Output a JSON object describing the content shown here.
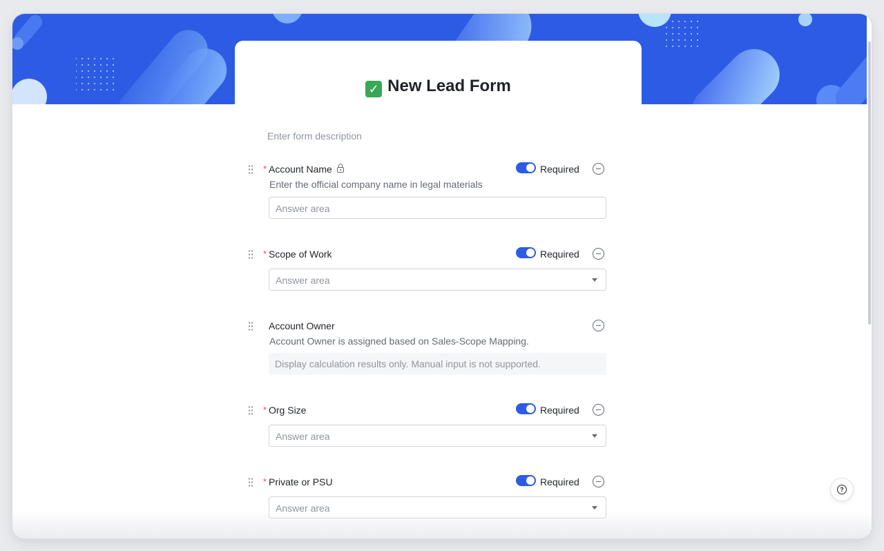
{
  "form": {
    "title_emoji": "✅",
    "title": "New Lead Form",
    "description_placeholder": "Enter form description",
    "fields": [
      {
        "label": "Account Name",
        "required_mark": "*",
        "helper": "Enter the official company name in legal materials",
        "required_label": "Required",
        "required": true,
        "locked": true,
        "input_type": "text",
        "placeholder": "Answer area"
      },
      {
        "label": "Scope of Work",
        "required_mark": "*",
        "required_label": "Required",
        "required": true,
        "input_type": "select",
        "placeholder": "Answer area"
      },
      {
        "label": "Account Owner",
        "helper": "Account Owner is assigned based on Sales-Scope Mapping.",
        "input_type": "readonly",
        "placeholder": "Display calculation results only. Manual input is not supported."
      },
      {
        "label": "Org Size",
        "required_mark": "*",
        "required_label": "Required",
        "required": true,
        "input_type": "select",
        "placeholder": "Answer area"
      },
      {
        "label": "Private or PSU",
        "required_mark": "*",
        "required_label": "Required",
        "required": true,
        "input_type": "select",
        "placeholder": "Answer area"
      }
    ]
  },
  "help": {
    "icon": "help-icon",
    "glyph": "?"
  },
  "colors": {
    "banner": "#2d5be3",
    "toggle_on": "#2d5be3",
    "required_star": "#f54a45"
  }
}
